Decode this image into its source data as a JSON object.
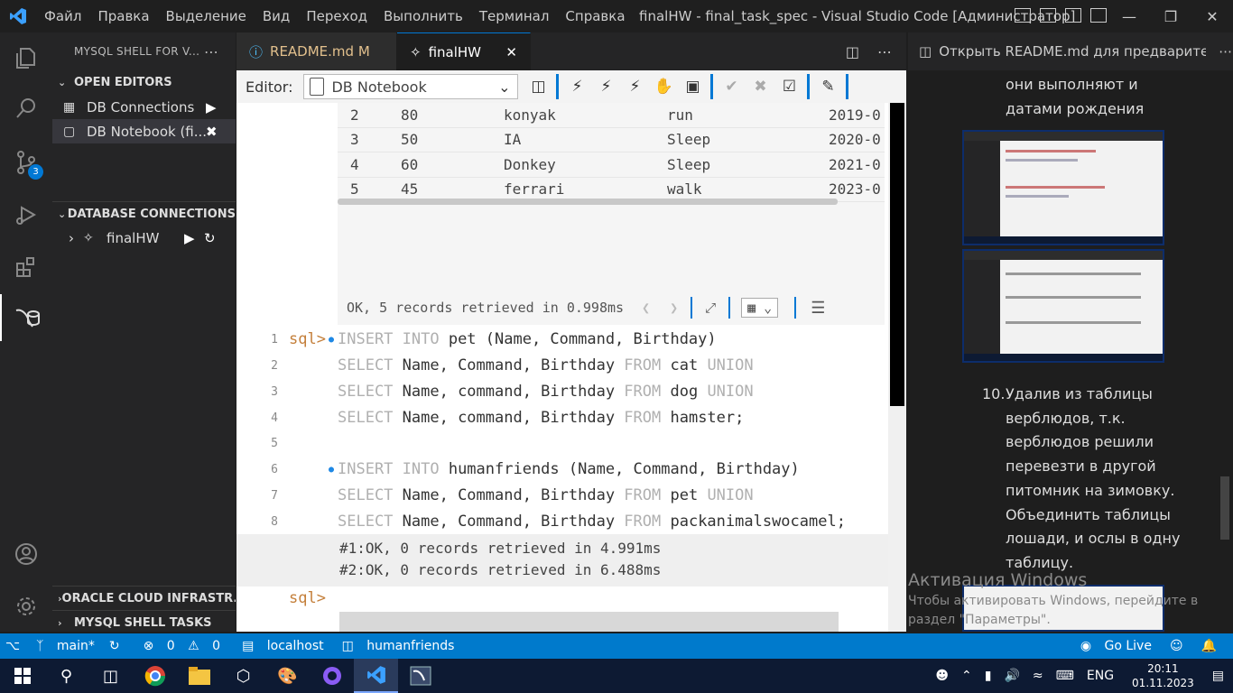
{
  "window": {
    "title": "finalHW - final_task_spec - Visual Studio Code [Администратор]"
  },
  "menu": [
    "Файл",
    "Правка",
    "Выделение",
    "Вид",
    "Переход",
    "Выполнить",
    "Терминал",
    "Справка"
  ],
  "activity": {
    "scm_badge": "3"
  },
  "sidebar": {
    "title": "MYSQL SHELL FOR V...",
    "open_editors_label": "OPEN EDITORS",
    "open_editors": [
      {
        "label": "DB Connections"
      },
      {
        "label": "DB Notebook (fi..."
      }
    ],
    "db_connections_label": "DATABASE CONNECTIONS",
    "connection": "finalHW",
    "oracle_label": "ORACLE CLOUD INFRASTR...",
    "tasks_label": "MYSQL SHELL TASKS"
  },
  "tabs": [
    {
      "label": "README.md",
      "badge": "M"
    },
    {
      "label": "finalHW"
    }
  ],
  "toolbar": {
    "editor_label": "Editor:",
    "editor_value": "DB Notebook"
  },
  "result": {
    "rows": [
      [
        "2",
        "80",
        "konyak",
        "run",
        "2019-0"
      ],
      [
        "3",
        "50",
        "IA",
        "Sleep",
        "2020-0"
      ],
      [
        "4",
        "60",
        "Donkey",
        "Sleep",
        "2021-0"
      ],
      [
        "5",
        "45",
        "ferrari",
        "walk",
        "2023-0"
      ]
    ],
    "status": "OK, 5 records retrieved in 0.998ms"
  },
  "code": {
    "prompt": "sql>",
    "lines": [
      {
        "n": "1",
        "pre": "",
        "kw1": "INSERT INTO",
        "rest": " pet (Name, Command, Birthday)",
        "kw2": ""
      },
      {
        "n": "2",
        "pre": "",
        "kw1": "SELECT",
        "rest": " Name, Command, Birthday ",
        "kw2": "FROM",
        "tail": " cat ",
        "kw3": "UNION"
      },
      {
        "n": "3",
        "pre": "",
        "kw1": "SELECT",
        "rest": " Name, command, Birthday ",
        "kw2": "FROM",
        "tail": " dog ",
        "kw3": "UNION"
      },
      {
        "n": "4",
        "pre": "",
        "kw1": "SELECT",
        "rest": " Name, command, Birthday ",
        "kw2": "FROM",
        "tail": " hamster;",
        "kw3": ""
      },
      {
        "n": "5",
        "pre": "",
        "kw1": "",
        "rest": "",
        "kw2": "",
        "tail": "",
        "kw3": ""
      },
      {
        "n": "6",
        "pre": "",
        "kw1": "INSERT INTO",
        "rest": " humanfriends (Name, Command, Birthday)",
        "kw2": "",
        "tail": "",
        "kw3": ""
      },
      {
        "n": "7",
        "pre": "",
        "kw1": "SELECT",
        "rest": " Name, Command, Birthday ",
        "kw2": "FROM",
        "tail": " pet ",
        "kw3": "UNION"
      },
      {
        "n": "8",
        "pre": "",
        "kw1": "SELECT",
        "rest": " Name, Command, Birthday ",
        "kw2": "FROM",
        "tail": " packanimalswocamel;",
        "kw3": ""
      }
    ],
    "output": [
      "#1:OK, 0 records retrieved in 4.991ms",
      "#2:OK, 0 records retrieved in 6.488ms"
    ]
  },
  "preview": {
    "title": "Открыть README.md для предварител",
    "text_top": [
      "они выполняют и",
      "датами рождения"
    ],
    "item_number": "10.",
    "item_text": [
      "Удалив из таблицы",
      "верблюдов, т.к.",
      "верблюдов решили",
      "перевезти в другой",
      "питомник на зимовку.",
      "Объединить таблицы",
      "лошади, и ослы в одну",
      "таблицу."
    ],
    "watermark_title": "Активация Windows",
    "watermark_line1": "Чтобы активировать Windows, перейдите в",
    "watermark_line2": "раздел \"Параметры\"."
  },
  "status": {
    "branch": "main*",
    "errors": "0",
    "warnings": "0",
    "host": "localhost",
    "db": "humanfriends",
    "golive": "Go Live"
  },
  "taskbar": {
    "lang": "ENG",
    "time": "20:11",
    "date": "01.11.2023"
  }
}
